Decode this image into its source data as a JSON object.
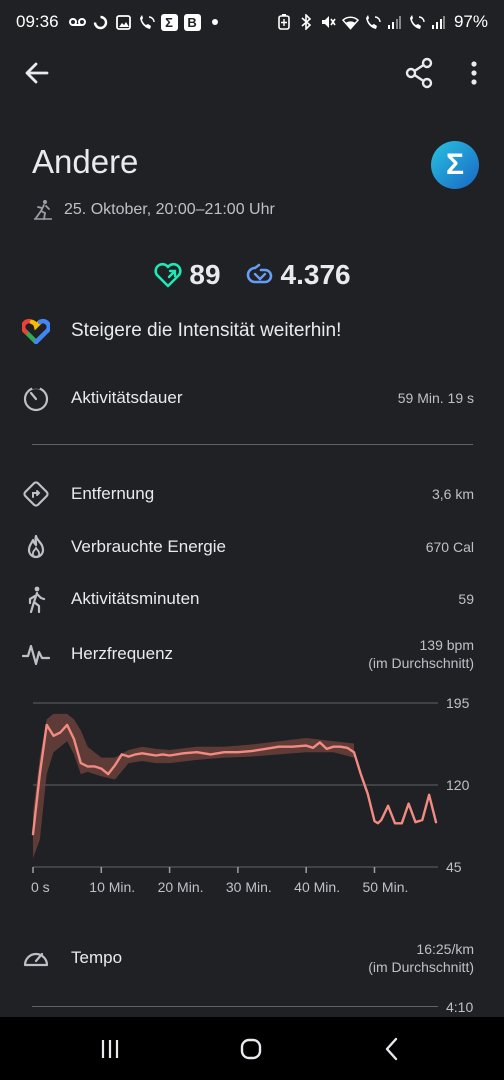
{
  "status_bar": {
    "time": "09:36",
    "battery": "97%",
    "left_icons": [
      "voicemail-icon",
      "sync-icon",
      "image-icon",
      "wifi-call-icon",
      "sigma-app-icon",
      "b-app-icon",
      "dot-icon"
    ],
    "right_icons": [
      "battery-saver-icon",
      "bluetooth-icon",
      "mute-icon",
      "wifi-icon",
      "wifi-call-icon",
      "signal-icon",
      "wifi-call-2-icon",
      "signal-2-icon"
    ],
    "sigma_glyph": "Σ",
    "b_glyph": "B"
  },
  "header": {
    "title": "Andere",
    "subtitle": "25. Oktober, 20:00–21:00 Uhr",
    "logo_glyph": "Σ"
  },
  "metrics": {
    "heart_points": "89",
    "steps": "4.376"
  },
  "insight": "Steigere die Intensität weiterhin!",
  "stats": {
    "duration": {
      "label": "Aktivitätsdauer",
      "value": "59 Min. 19 s"
    },
    "distance": {
      "label": "Entfernung",
      "value": "3,6 km"
    },
    "energy": {
      "label": "Verbrauchte Energie",
      "value": "670 Cal"
    },
    "active_minutes": {
      "label": "Aktivitätsminuten",
      "value": "59"
    },
    "heart_rate": {
      "label": "Herzfrequenz",
      "value": "139 bpm",
      "note": "(im Durchschnitt)"
    },
    "pace": {
      "label": "Tempo",
      "value": "16:25/km",
      "note": "(im Durchschnitt)"
    },
    "pace_axis_top": "4:10"
  },
  "colors": {
    "background": "#202124",
    "line": "#f28b82",
    "band": "#6b3f3c",
    "heart_green": "#1de9b6",
    "steps_blue": "#669df6"
  },
  "chart_data": {
    "type": "line",
    "title": "",
    "xlabel": "",
    "ylabel": "",
    "x_ticks": [
      "0 s",
      "10 Min.",
      "20 Min.",
      "30 Min.",
      "40 Min.",
      "50 Min."
    ],
    "x_tick_values": [
      0,
      10,
      20,
      30,
      40,
      50
    ],
    "y_ticks": [
      "195",
      "120",
      "45"
    ],
    "y_tick_values": [
      195,
      120,
      45
    ],
    "xlim": [
      0,
      59.3
    ],
    "ylim": [
      45,
      195
    ],
    "grid": true,
    "series": [
      {
        "x": [
          0,
          1,
          2,
          3,
          4,
          5,
          6,
          7,
          8,
          9,
          10,
          11,
          12,
          13,
          14,
          15,
          16,
          17,
          18,
          19,
          20,
          22,
          24,
          26,
          28,
          30,
          32,
          34,
          36,
          38,
          40,
          41,
          42,
          43,
          44,
          45,
          46,
          47,
          48,
          49,
          50,
          50.5,
          51,
          52,
          53,
          54,
          55,
          56,
          57,
          58,
          59
        ],
        "y": [
          75,
          130,
          175,
          165,
          168,
          175,
          162,
          140,
          137,
          137,
          135,
          130,
          138,
          148,
          146,
          148,
          149,
          148,
          147,
          148,
          147,
          149,
          150,
          148,
          150,
          150,
          151,
          153,
          155,
          155,
          156,
          154,
          159,
          153,
          155,
          155,
          154,
          150,
          130,
          112,
          87,
          85,
          88,
          101,
          85,
          85,
          103,
          86,
          88,
          111,
          86
        ]
      }
    ],
    "band": {
      "x": [
        0,
        1,
        2,
        3,
        4,
        5,
        6,
        7,
        8,
        9,
        10,
        12,
        14,
        16,
        18,
        20,
        24,
        28,
        32,
        36,
        40,
        44,
        47
      ],
      "upper": [
        95,
        145,
        180,
        185,
        185,
        185,
        180,
        170,
        155,
        150,
        145,
        145,
        152,
        155,
        153,
        152,
        155,
        155,
        157,
        160,
        163,
        160,
        158
      ],
      "lower": [
        53,
        70,
        130,
        150,
        155,
        160,
        148,
        130,
        132,
        130,
        128,
        125,
        140,
        142,
        140,
        140,
        143,
        145,
        146,
        148,
        150,
        150,
        145
      ]
    }
  },
  "nav": {
    "recents_glyph": "|||",
    "home_glyph": "◯",
    "back_glyph": "‹"
  }
}
